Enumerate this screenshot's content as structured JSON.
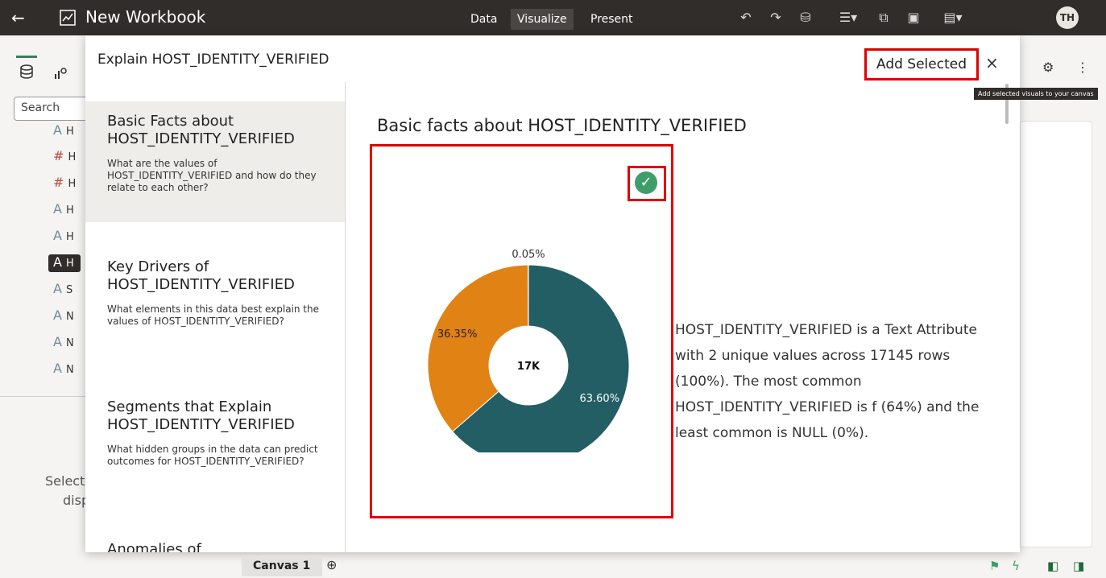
{
  "topbar": {
    "title": "New Workbook",
    "tabs": [
      "Data",
      "Visualize",
      "Present"
    ],
    "active_tab": "Visualize",
    "avatar_initials": "TH"
  },
  "background": {
    "search_placeholder": "Search",
    "data_items": [
      {
        "glyph": "A",
        "text": "H"
      },
      {
        "glyph": "#",
        "text": "H"
      },
      {
        "glyph": "#",
        "text": "H"
      },
      {
        "glyph": "A",
        "text": "H"
      },
      {
        "glyph": "A",
        "text": "H"
      },
      {
        "glyph": "A",
        "text": "H"
      },
      {
        "glyph": "A",
        "text": "S"
      },
      {
        "glyph": "A",
        "text": "N"
      },
      {
        "glyph": "A",
        "text": "N"
      },
      {
        "glyph": "A",
        "text": "N"
      }
    ],
    "select_hint_line1": "Select",
    "select_hint_line2": "disp",
    "tooltip": "Add selected visuals to your canvas",
    "canvas_tab": "Canvas 1"
  },
  "modal": {
    "title": "Explain HOST_IDENTITY_VERIFIED",
    "add_button": "Add Selected",
    "close_glyph": "×",
    "nav": [
      {
        "heading": "Basic Facts about HOST_IDENTITY_VERIFIED",
        "desc": "What are the values of HOST_IDENTITY_VERIFIED and how do they relate to each other?"
      },
      {
        "heading": "Key Drivers of HOST_IDENTITY_VERIFIED",
        "desc": "What elements in this data best explain the values of HOST_IDENTITY_VERIFIED?"
      },
      {
        "heading": "Segments that Explain HOST_IDENTITY_VERIFIED",
        "desc": "What hidden groups in the data can predict outcomes for HOST_IDENTITY_VERIFIED?"
      },
      {
        "heading": "Anomalies of HOST_IDENTITY_VERIFIED",
        "desc": ""
      }
    ],
    "section_title": "Basic facts about HOST_IDENTITY_VERIFIED",
    "check_glyph": "✓",
    "description": "HOST_IDENTITY_VERIFIED is a Text Attribute with 2 unique values across 17145 rows (100%). The most common HOST_IDENTITY_VERIFIED is f (64%) and the least common is NULL (0%)."
  },
  "chart_data": {
    "type": "pie",
    "donut": true,
    "center_label": "17K",
    "slices": [
      {
        "value": 63.6,
        "label": "63.60%",
        "color": "#225e64"
      },
      {
        "value": 36.35,
        "label": "36.35%",
        "color": "#e08214"
      },
      {
        "value": 0.05,
        "label": "0.05%",
        "color": "#9e9e9e"
      }
    ]
  },
  "colors": {
    "topbar_bg": "#312d2a",
    "highlight_red": "#e00000",
    "check_green": "#3e9e6a"
  }
}
